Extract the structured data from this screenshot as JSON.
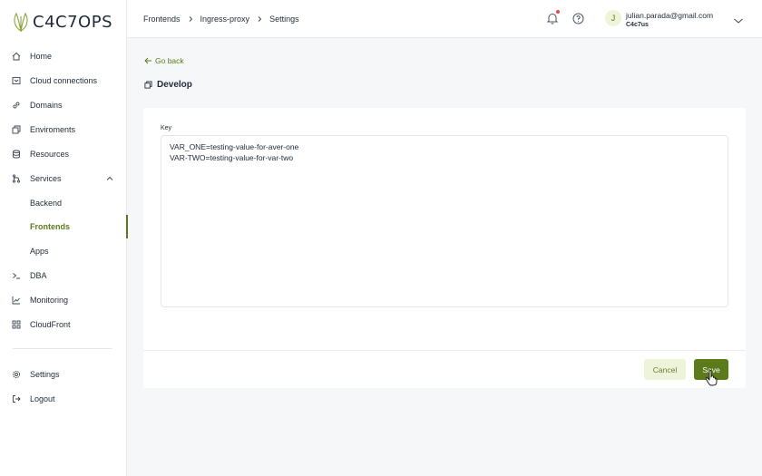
{
  "app": {
    "logo_text": "C4C7OPS"
  },
  "sidebar": {
    "items": [
      {
        "label": "Home",
        "icon": "home-icon"
      },
      {
        "label": "Cloud connections",
        "icon": "cloud-connections-icon"
      },
      {
        "label": "Domains",
        "icon": "link-icon"
      },
      {
        "label": "Enviroments",
        "icon": "layers-icon"
      },
      {
        "label": "Resources",
        "icon": "database-icon"
      },
      {
        "label": "Services",
        "icon": "git-branch-icon",
        "expanded": true
      },
      {
        "label": "Backend",
        "sub": true
      },
      {
        "label": "Frontends",
        "sub": true,
        "active": true
      },
      {
        "label": "Apps",
        "sub": true
      },
      {
        "label": "DBA",
        "icon": "terminal-icon"
      },
      {
        "label": "Monitoring",
        "icon": "chart-line-icon"
      },
      {
        "label": "CloudFront",
        "icon": "grid-icon"
      }
    ],
    "bottom": [
      {
        "label": "Settings",
        "icon": "gear-icon"
      },
      {
        "label": "Logout",
        "icon": "logout-icon"
      }
    ]
  },
  "header": {
    "breadcrumbs": [
      "Frontends",
      "Ingress-proxy",
      "Settings"
    ],
    "user": {
      "initial": "J",
      "email": "julian.parada@gmail.com",
      "org": "C4c7us"
    }
  },
  "main": {
    "go_back": "Go back",
    "section_title": "Develop",
    "key_label": "Key",
    "key_value": "VAR_ONE=testing-value-for-aver-one\nVAR-TWO=testing-value-for-var-two",
    "cancel_label": "Cancel",
    "save_label": "Save"
  },
  "colors": {
    "accent": "#5b7a1a",
    "accent_light": "#eef4d9",
    "notification": "#e5484d"
  }
}
